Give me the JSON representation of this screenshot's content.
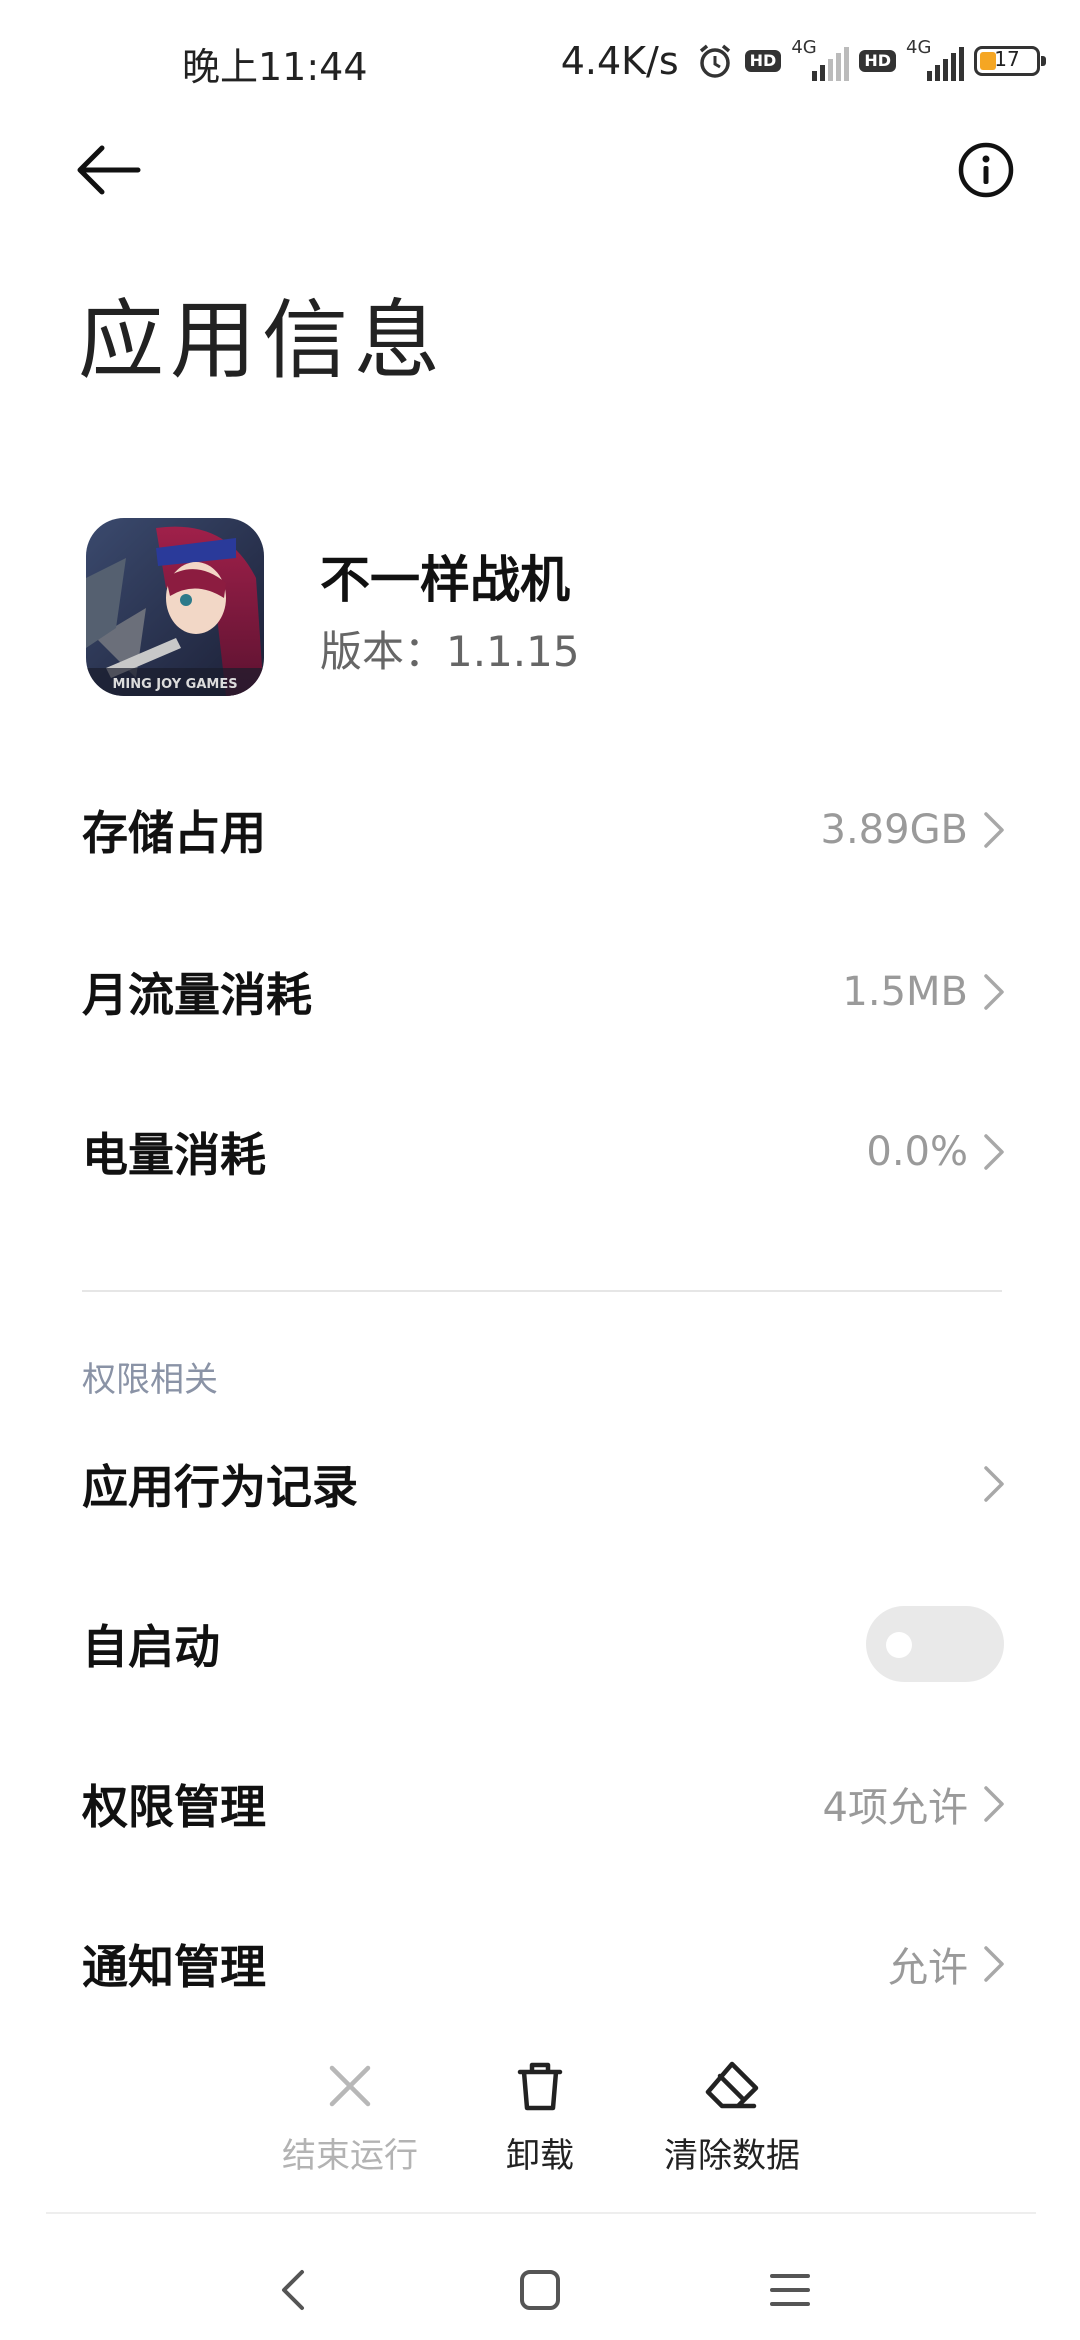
{
  "status_bar": {
    "time": "晚上11:44",
    "net_speed": "4.4K/s",
    "hd1": "HD",
    "hd2": "HD",
    "net1": "4G",
    "net2": "4G",
    "battery": "17",
    "battery_color": "#f5a623"
  },
  "header": {
    "title": "应用信息",
    "back_icon": "back-arrow-icon",
    "info_icon": "info-icon"
  },
  "app": {
    "name": "不一样战机",
    "version": "版本：1.1.15",
    "icon_text": "MING JOY GAMES"
  },
  "rows": {
    "storage": {
      "label": "存储占用",
      "value": "3.89GB"
    },
    "traffic": {
      "label": "月流量消耗",
      "value": "1.5MB"
    },
    "battery": {
      "label": "电量消耗",
      "value": "0.0%"
    }
  },
  "permissions_section": {
    "title": "权限相关",
    "behavior": {
      "label": "应用行为记录"
    },
    "autostart": {
      "label": "自启动",
      "enabled": false
    },
    "permission_mgmt": {
      "label": "权限管理",
      "value": "4项允许"
    },
    "notification_mgmt": {
      "label": "通知管理",
      "value": "允许"
    }
  },
  "actions": {
    "stop": "结束运行",
    "uninstall": "卸载",
    "clear": "清除数据"
  },
  "nav": {
    "back": "nav-back-icon",
    "home": "nav-home-icon",
    "recents": "nav-menu-icon"
  }
}
